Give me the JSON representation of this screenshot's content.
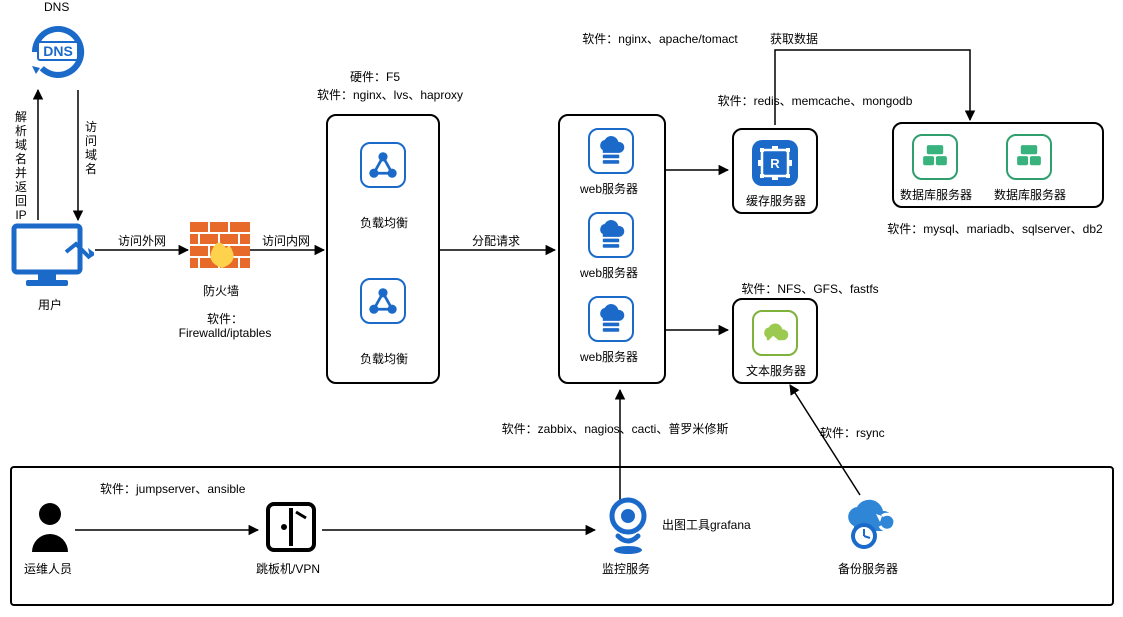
{
  "dns": {
    "label": "DNS"
  },
  "user": {
    "label": "用户"
  },
  "dns_resolve": "解析域名并返回IP",
  "dns_visit": "访问域名",
  "internet": "访问外网",
  "intranet": "访问内网",
  "dispatch": "分配请求",
  "firewall": {
    "label": "防火墙",
    "soft_lbl": "软件：",
    "soft": "Firewalld/iptables"
  },
  "lb": {
    "hard_lbl": "硬件：F5",
    "soft_lbl": "软件：nginx、lvs、haproxy",
    "item": "负载均衡"
  },
  "web": {
    "soft_lbl": "软件：nginx、apache/tomact",
    "item": "web服务器"
  },
  "cache": {
    "soft_lbl": "软件：redis、memcache、mongodb",
    "item": "缓存服务器"
  },
  "file": {
    "soft_lbl": "软件：NFS、GFS、fastfs",
    "item": "文本服务器"
  },
  "db": {
    "soft_lbl": "软件：mysql、mariadb、sqlserver、db2",
    "item": "数据库服务器"
  },
  "fetch": "获取数据",
  "monitor": {
    "soft_lbl": "软件：zabbix、nagios、cacti、普罗米修斯",
    "label": "监控服务",
    "grafana": "出图工具grafana"
  },
  "backup": {
    "soft_lbl": "软件：rsync",
    "label": "备份服务器"
  },
  "ops": {
    "label": "运维人员"
  },
  "bastion": {
    "soft_lbl": "软件：jumpserver、ansible",
    "label": "跳板机/VPN"
  }
}
